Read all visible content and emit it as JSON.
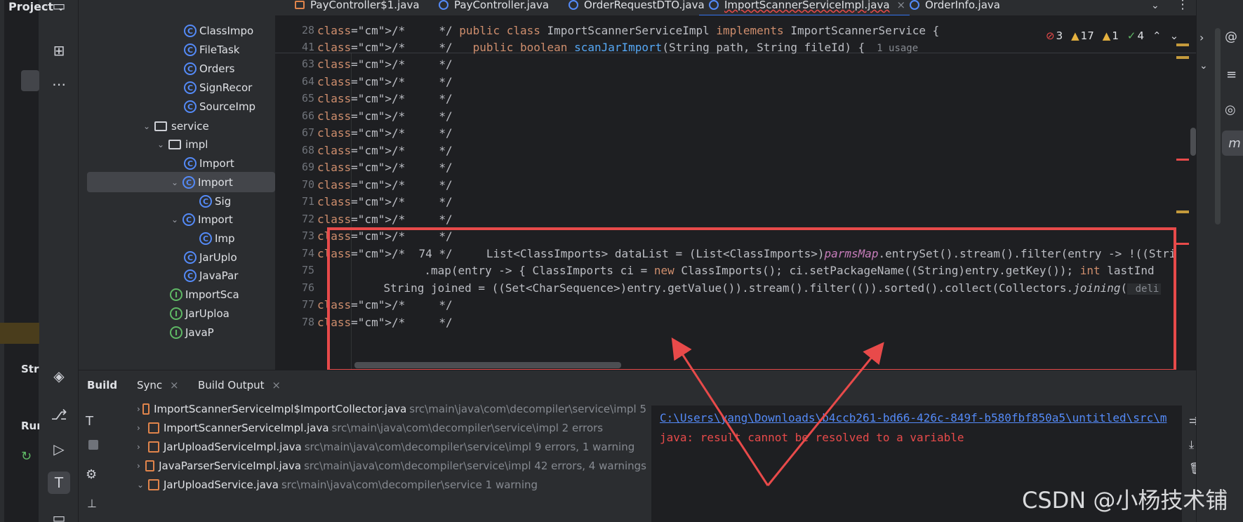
{
  "project": {
    "title": "Project",
    "items": [
      {
        "label": "ClassImpo",
        "kind": "class",
        "indent": 2
      },
      {
        "label": "FileTask",
        "kind": "class",
        "indent": 2
      },
      {
        "label": "Orders",
        "kind": "class",
        "indent": 2
      },
      {
        "label": "SignRecor",
        "kind": "class",
        "indent": 2
      },
      {
        "label": "SourceImp",
        "kind": "class",
        "indent": 2
      },
      {
        "label": "service",
        "kind": "folder",
        "indent": 0,
        "expanded": true
      },
      {
        "label": "impl",
        "kind": "folder",
        "indent": 1,
        "expanded": true
      },
      {
        "label": "Import",
        "kind": "class",
        "indent": 2,
        "selected": true
      },
      {
        "label": "Import",
        "kind": "class",
        "indent": 2,
        "expanded": true
      },
      {
        "label": "Sig",
        "kind": "class",
        "indent": 3
      },
      {
        "label": "Import",
        "kind": "class",
        "indent": 2,
        "expanded": true
      },
      {
        "label": "Imp",
        "kind": "class",
        "indent": 3
      },
      {
        "label": "JarUplo",
        "kind": "class",
        "indent": 2
      },
      {
        "label": "JavaPar",
        "kind": "class",
        "indent": 2
      },
      {
        "label": "ImportSca",
        "kind": "interface",
        "indent": 1
      },
      {
        "label": "JarUploa",
        "kind": "interface",
        "indent": 1
      },
      {
        "label": "JavaP",
        "kind": "interface",
        "indent": 1
      }
    ]
  },
  "left_labels": {
    "structure": "Stru",
    "run": "Run"
  },
  "tabs": [
    {
      "label": "PayController$1.java",
      "active": false
    },
    {
      "label": "PayController.java",
      "active": false
    },
    {
      "label": "OrderRequestDTO.java",
      "active": false
    },
    {
      "label": "ImportScannerServiceImpl.java",
      "active": true
    },
    {
      "label": "OrderInfo.java",
      "active": false
    }
  ],
  "inspections": {
    "errors": "3",
    "warnings": "17",
    "weak": "1",
    "ok": "4"
  },
  "sticky": [
    {
      "line": "28",
      "text": "/*     */ public class ImportScannerServiceImpl implements ImportScannerService {"
    },
    {
      "line": "41",
      "text": "/*     */   public boolean scanJarImport(String path, String fileId) {",
      "hint": "1 usage"
    }
  ],
  "code_lines": [
    {
      "line": "63",
      "text": "/*     */"
    },
    {
      "line": "64",
      "text": "/*     */"
    },
    {
      "line": "65",
      "text": "/*     */"
    },
    {
      "line": "66",
      "text": "/*     */"
    },
    {
      "line": "67",
      "text": "/*     */"
    },
    {
      "line": "68",
      "text": "/*     */"
    },
    {
      "line": "69",
      "text": "/*     */"
    },
    {
      "line": "70",
      "text": "/*     */"
    },
    {
      "line": "71",
      "text": "/*     */"
    },
    {
      "line": "72",
      "text": "/*     */"
    },
    {
      "line": "73",
      "text": "/*     */"
    },
    {
      "line": "74",
      "text": "/*  74 */     List<ClassImports> dataList = (List<ClassImports>)parmsMap.entrySet().stream().filter(entry -> !((String)"
    },
    {
      "line": "75",
      "text": "          .map(entry -> { ClassImports ci = new ClassImports(); ci.setPackageName((String)entry.getKey()); int lastInd"
    },
    {
      "line": "76",
      "text": "    String joined = ((Set<CharSequence>)entry.getValue()).stream().filter(()).sorted().collect(Collectors.joining(",
      "hint": "deli"
    },
    {
      "line": "77",
      "text": "/*     */"
    },
    {
      "line": "78",
      "text": "/*     */"
    }
  ],
  "bottom": {
    "tabs": [
      "Build",
      "Sync",
      "Build Output"
    ],
    "rows": [
      {
        "file": "ImportScannerServiceImpl$ImportCollector.java",
        "path": "src\\main\\java\\com\\decompiler\\service\\impl 5",
        "expanded": false
      },
      {
        "file": "ImportScannerServiceImpl.java",
        "path": "src\\main\\java\\com\\decompiler\\service\\impl 2 errors",
        "expanded": false
      },
      {
        "file": "JarUploadServiceImpl.java",
        "path": "src\\main\\java\\com\\decompiler\\service\\impl 9 errors, 1 warning",
        "expanded": false
      },
      {
        "file": "JavaParserServiceImpl.java",
        "path": "src\\main\\java\\com\\decompiler\\service\\impl 42 errors, 4 warnings",
        "expanded": false
      },
      {
        "file": "JarUploadService.java",
        "path": "src\\main\\java\\com\\decompiler\\service 1 warning",
        "expanded": true
      }
    ],
    "output_link": "C:\\Users\\yang\\Downloads\\b4ccb261-bd66-426c-849f-b580fbf850a5\\untitled\\src\\m",
    "output_error": "java: result cannot be resolved to a variable"
  },
  "watermark": "CSDN @小杨技术铺",
  "colors": {
    "accent": "#3574f0",
    "error": "#e84a4a",
    "link": "#548af7"
  }
}
